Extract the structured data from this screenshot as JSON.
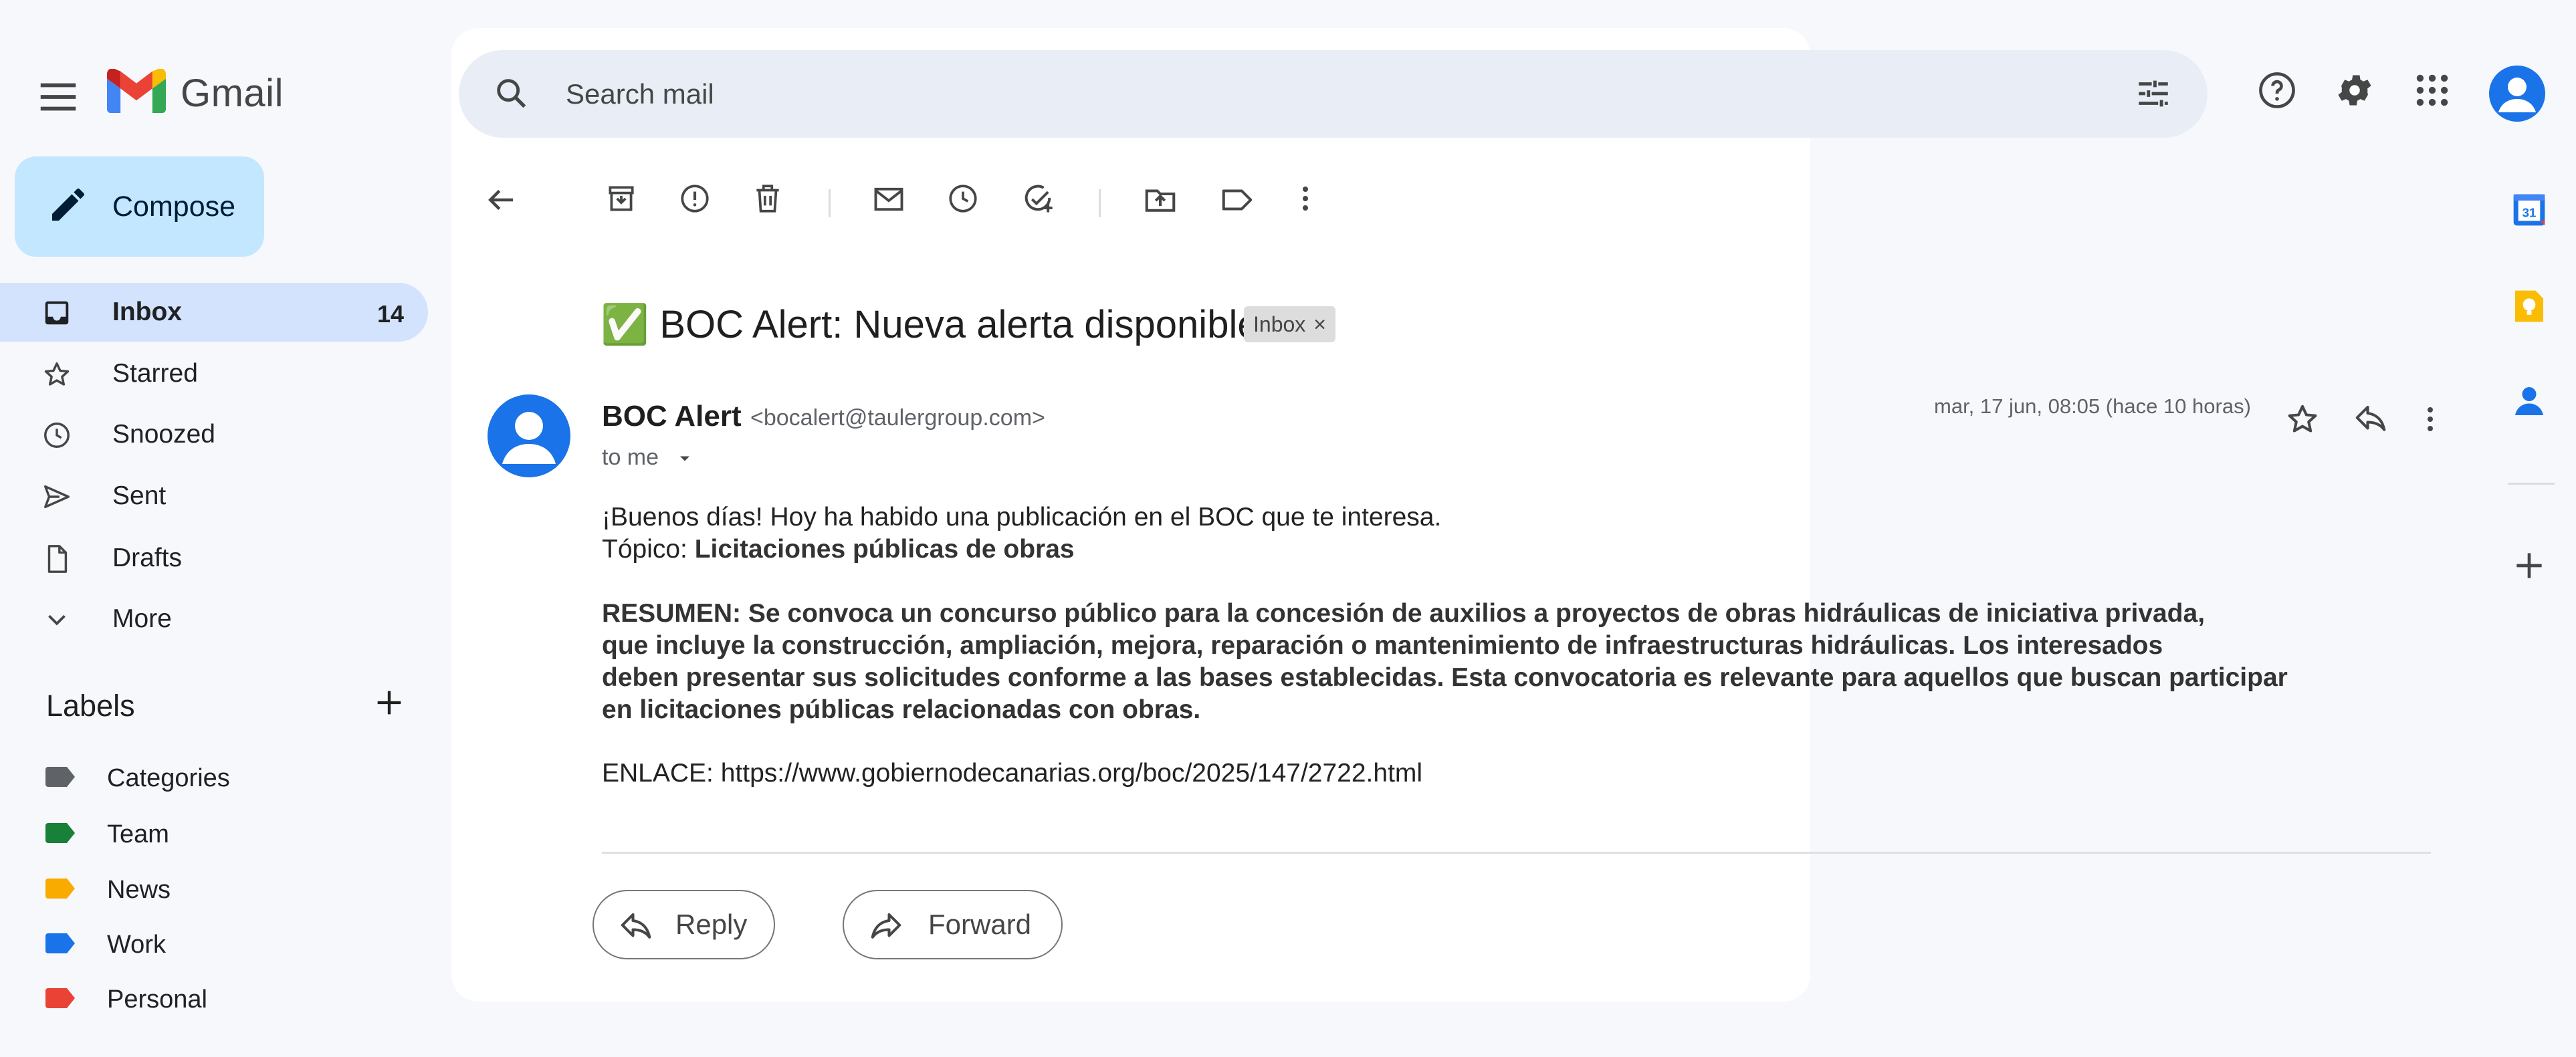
{
  "app": {
    "name": "Gmail"
  },
  "compose": {
    "label": "Compose"
  },
  "nav": [
    {
      "id": "inbox",
      "label": "Inbox",
      "count": "14",
      "icon": "inbox-icon",
      "active": true
    },
    {
      "id": "starred",
      "label": "Starred",
      "icon": "star-icon"
    },
    {
      "id": "snoozed",
      "label": "Snoozed",
      "icon": "clock-icon"
    },
    {
      "id": "sent",
      "label": "Sent",
      "icon": "send-icon"
    },
    {
      "id": "drafts",
      "label": "Drafts",
      "icon": "draft-icon"
    },
    {
      "id": "more",
      "label": "More",
      "icon": "chevron-down-icon"
    }
  ],
  "labels": {
    "title": "Labels",
    "items": [
      {
        "label": "Categories",
        "color": "#5f6368"
      },
      {
        "label": "Team",
        "color": "#188038"
      },
      {
        "label": "News",
        "color": "#f9ab00"
      },
      {
        "label": "Work",
        "color": "#1a73e8"
      },
      {
        "label": "Personal",
        "color": "#ea4335"
      }
    ]
  },
  "search": {
    "placeholder": "Search mail"
  },
  "email": {
    "subject_emoji": "✅",
    "subject": "BOC Alert: Nueva alerta disponible",
    "chip": "Inbox",
    "chip_close": "×",
    "sender_name": "BOC Alert",
    "sender_email": "<bocalert@taulergroup.com>",
    "to": "to me",
    "date": "mar, 17 jun, 08:05 (hace 10 horas)",
    "greeting": "¡Buenos días! Hoy ha habido una publicación en el BOC que te interesa.",
    "topic_label": "Tópico: ",
    "topic": "Licitaciones públicas de obras",
    "summary_lines": [
      "RESUMEN: Se convoca un concurso público para la concesión de auxilios a proyectos de obras hidráulicas de iniciativa privada,",
      "que incluye la construcción, ampliación, mejora, reparación o mantenimiento de infraestructuras hidráulicas. Los interesados",
      "deben presentar sus solicitudes conforme a las bases establecidas. Esta convocatoria es relevante para aquellos que buscan participar",
      "en licitaciones públicas relacionadas con obras."
    ],
    "link": "ENLACE: https://www.gobiernodecanarias.org/boc/2025/147/2722.html"
  },
  "actions": {
    "reply": "Reply",
    "forward": "Forward"
  },
  "colors": {
    "accent": "#1a73e8",
    "compose_bg": "#c2e7ff",
    "active_nav": "#d3e3fd",
    "page_bg": "#f6f8fc"
  }
}
